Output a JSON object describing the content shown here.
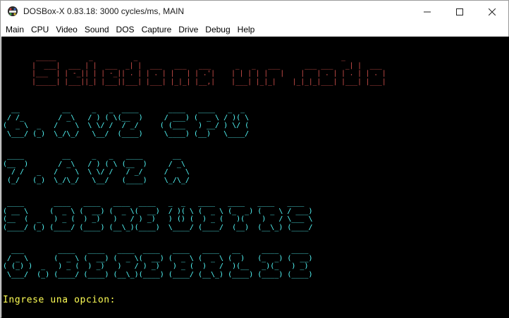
{
  "window": {
    "title": "DOSBox-X 0.83.18: 3000 cycles/ms, MAIN"
  },
  "menu": [
    "Main",
    "CPU",
    "Video",
    "Sound",
    "DOS",
    "Capture",
    "Drive",
    "Debug",
    "Help"
  ],
  "screen": {
    "banner": "     _____        _          _                                                  _\n    |  ___|  ___ | |  ___  _| |  ___   ___   ___      _   _   ___      ___ ___   _| |  ___\n    |___  | | -_|| | | -_|| . | | . | |   | | .'|    | | | | |   |    |   | . | | . | | . |\n    |_____| |___||_| |___||___| |___| |_|_| |__,|    |___| |_|_|    |_|_|_|___| |___| |___|",
    "option_1": "  __          __     _   _  ____       ____   ____   _  _\n / /_        / _\\   / ) ( \\(__  )     / ___) (  _ \\ / )( \\\n(  _ \\  _   /    \\  \\ \\/ /  / _/     ( (___   ) __/ ) \\/ (\n \\___/ (_)  \\_/\\_/   \\__/  (____)     \\____) (__)   \\____/",
    "option_2": " ____         __     _   _   ____       __\n(__  )       / _\\   / ) ( \\ (__  )     / _\\\n  / /   _   /    \\  \\ \\/ /   / _/     /    \\\n (_/   (_)  \\_/\\_/   \\__/   (____)    \\_/\\_/",
    "option_3": " ____       ____   ____   ____  ____   _  _   ____   ____   ____   ____\n( __ \\     (  _ \\ (  __) (  _ \\(  __)  / )( \\ (  _ \\ (_  _) (  _ \\ / ___)\n(__  (  _   ) _ (  ) _)   )   / ) _)   ) () (  ) _ (   )(    )   / \\___ \\\n(____/ (_) (____/ (____) (__\\_)(____)  \\____/ (____/  (__)  (__\\_) (____/",
    "option_4": "  ___        ____   ____   ____  ____   ____   ____   __     ____   ____\n / _ \\      (  _ \\ (  __) (  _ \\(  __) (  _ \\ (  _ \\ (  )   (_  _) (  __)\n( (_) )  _   ) _ (  ) _)   )   / ) _)   ) _ (  )   /  )(__   _)(_   ) _)\n \\___/  (_) (____/ (____) (__\\_)(____) (____/ (__\\_) (____) (____) (____)",
    "prompt": "Ingrese una opcion:"
  }
}
